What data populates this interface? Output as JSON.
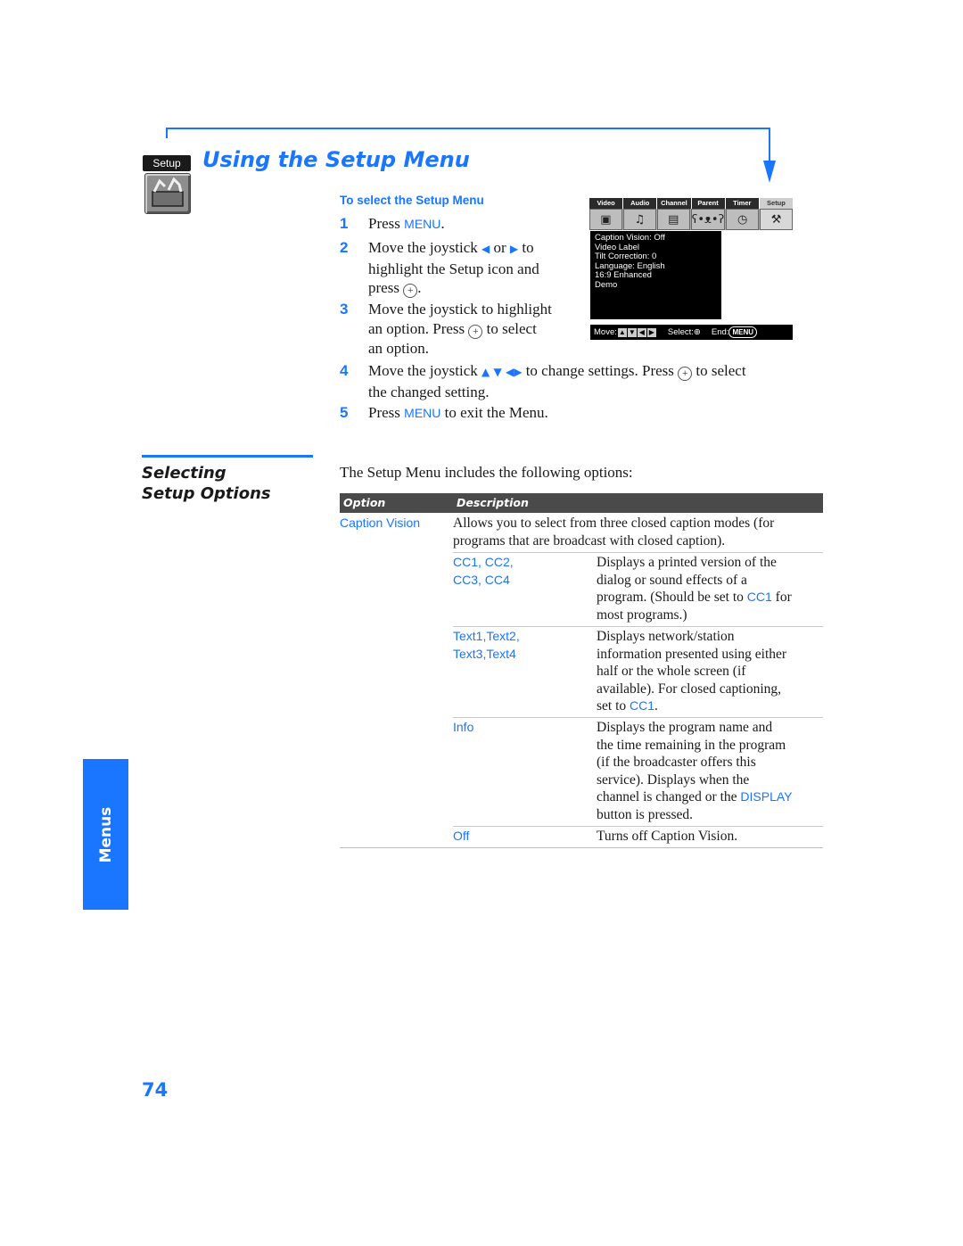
{
  "header": {
    "badge_label": "Setup",
    "title": "Using the Setup Menu"
  },
  "procedure": {
    "heading": "To select the Setup Menu",
    "steps": [
      {
        "num": "1",
        "pre": "Press ",
        "kw": "MENU",
        "post": "."
      },
      {
        "num": "2",
        "l1a": "Move the joystick ",
        "l1b": " or ",
        "l1c": " to",
        "l2": "highlight the Setup icon and",
        "l3a": "press ",
        "l3b": "."
      },
      {
        "num": "3",
        "l1": "Move the joystick to highlight",
        "l2a": "an option. Press ",
        "l2b": " to select",
        "l3": "an option."
      },
      {
        "num": "4",
        "l1a": "Move the joystick ",
        "l1b": " to change settings. Press ",
        "l1c": " to select",
        "l2": "the changed setting."
      },
      {
        "num": "5",
        "pre": "Press ",
        "kw": "MENU",
        "post": " to exit the Menu."
      }
    ],
    "icons": {
      "left_arrow": "◆",
      "right_arrow": "➜",
      "select_button": "⊕"
    }
  },
  "tv_menu": {
    "tabs": [
      "Video",
      "Audio",
      "Channel",
      "Parent",
      "Timer",
      "Setup"
    ],
    "active_tab": "Setup",
    "tab_icons": [
      "picture-icon",
      "music-notes-icon",
      "channel-cards-icon",
      "bear-icon",
      "clock-icon",
      "toolbox-icon"
    ],
    "items": [
      "Caption Vision: Off",
      "Video Label",
      "Tilt Correction: 0",
      "Language: English",
      "16:9 Enhanced",
      "Demo"
    ],
    "footer": {
      "move": "Move:",
      "select": "Select:",
      "end": "End:",
      "menu_key": "MENU"
    }
  },
  "section": {
    "title_line1": "Selecting",
    "title_line2": "Setup Options",
    "intro": "The Setup Menu includes the following options:"
  },
  "table": {
    "headers": {
      "option": "Option",
      "description": "Description"
    },
    "main_option": "Caption Vision",
    "main_desc_l1": "Allows you to select from three closed caption modes (for",
    "main_desc_l2": "programs that are broadcast with closed caption).",
    "sub_rows": [
      {
        "opt_l1": "CC1, CC2,",
        "opt_l2": "CC3, CC4",
        "desc": [
          "Displays a printed version of the",
          "dialog or sound effects of a",
          "program. (Should be set to ",
          "CC1",
          " for",
          "most programs.)"
        ]
      },
      {
        "opt_l1": "Text1,Text2,",
        "opt_l2": "Text3,Text4",
        "desc": [
          "Displays network/station",
          "information presented using either",
          "half or the whole screen (if",
          "available). For closed captioning,",
          "set to ",
          "CC1",
          "."
        ]
      },
      {
        "opt_l1": "Info",
        "desc": [
          "Displays the program name and",
          "the time remaining in the program",
          "(if the broadcaster offers this",
          "service). Displays when the",
          "channel is changed or the ",
          "DISPLAY",
          "button is pressed."
        ]
      },
      {
        "opt_l1": "Off",
        "desc": [
          "Turns off Caption Vision."
        ]
      }
    ]
  },
  "side_tab": "Menus",
  "page_number": "74",
  "colors": {
    "accent": "#1a75ff",
    "table_header": "#4a4a4a"
  }
}
